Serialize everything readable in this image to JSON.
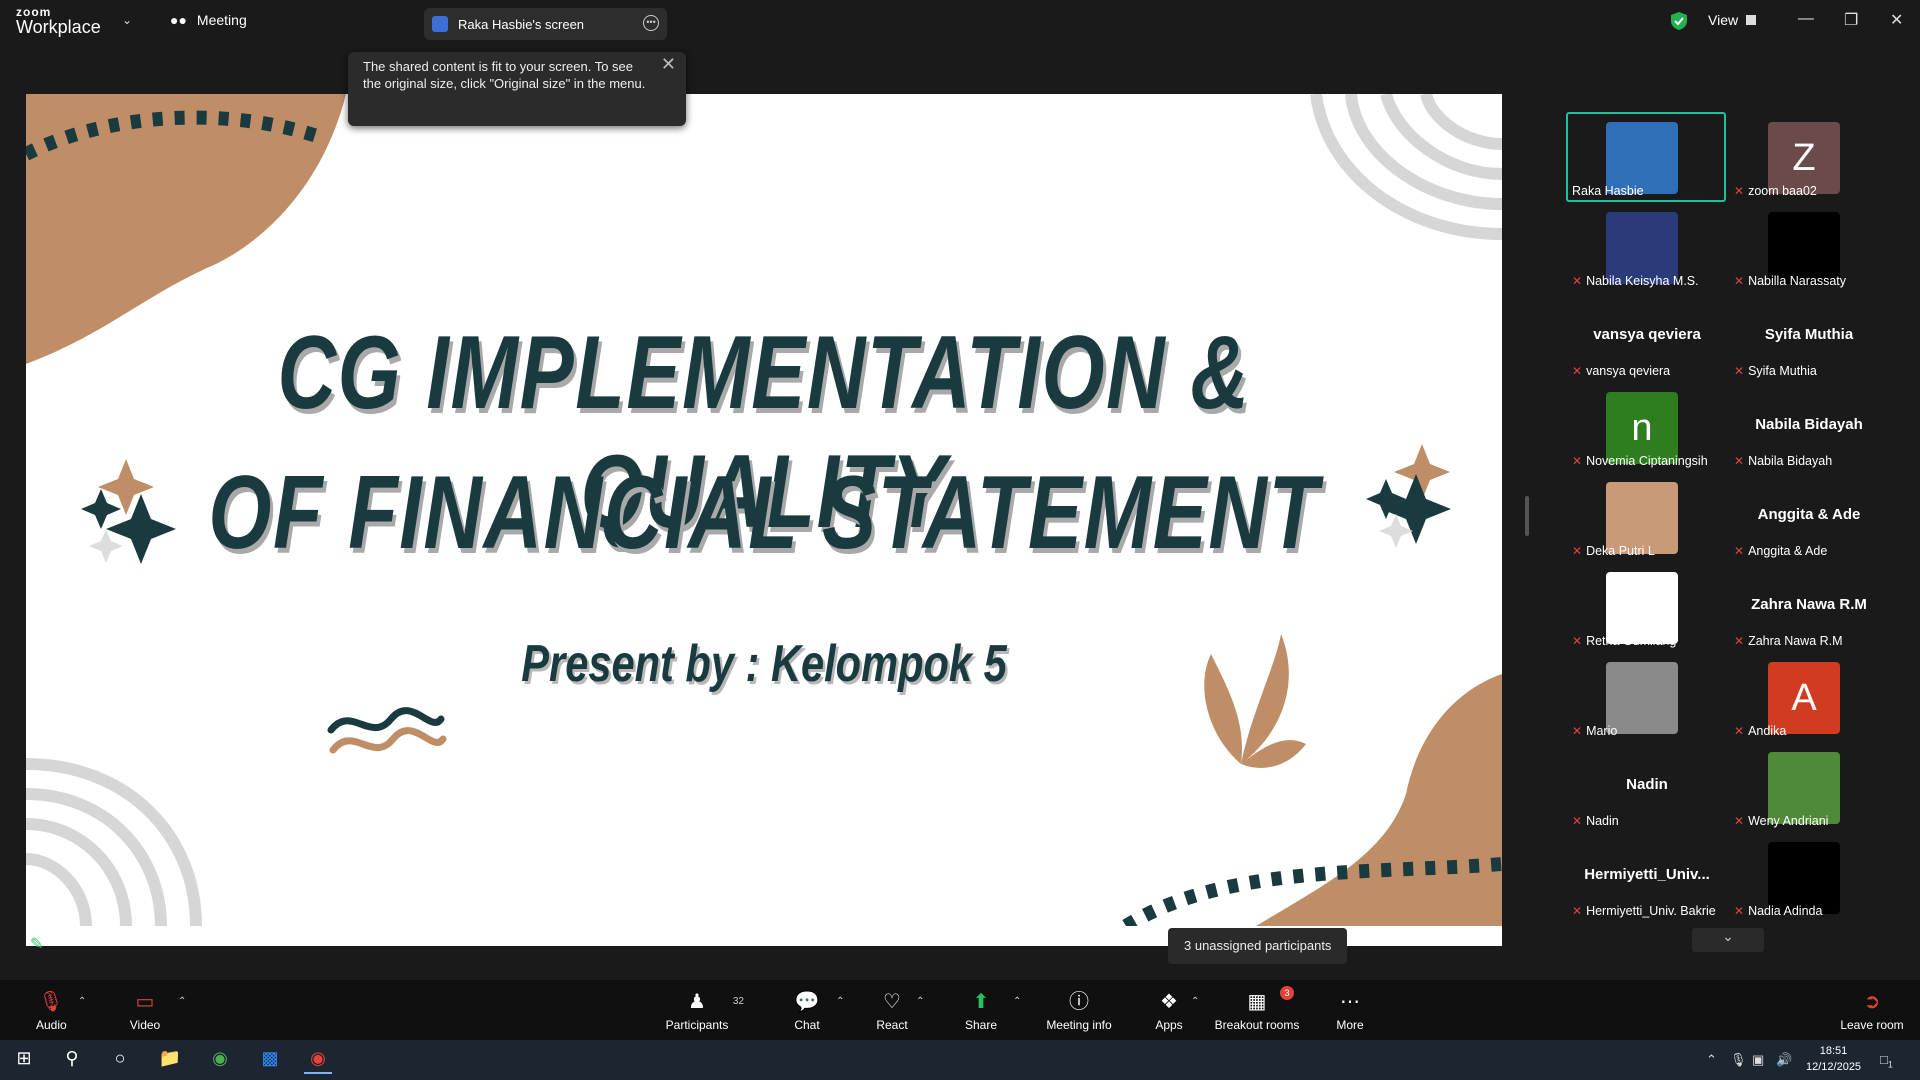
{
  "app": {
    "brand_top": "zoom",
    "brand_bottom": "Workplace"
  },
  "titlebar": {
    "meeting_label": "Meeting",
    "screen_tab": "Raka Hasbie's screen",
    "view_label": "View"
  },
  "tooltip": {
    "text": "The shared content is fit to your screen. To see the original size, click \"Original size\" in the menu."
  },
  "slide": {
    "title_line1": "CG IMPLEMENTATION & QUALITY",
    "title_line2": "OF FINANCIAL STATEMENT",
    "presenter": "Present by : Kelompok 5"
  },
  "unassigned": "3 unassigned participants",
  "participants": [
    {
      "name": "Raka Hasbie",
      "tile": "photo-orca",
      "color": "#2f6fb8",
      "muted": false
    },
    {
      "name": "zoom baa02",
      "tile": "Z",
      "color": "#6b4a4a",
      "muted": true
    },
    {
      "name": "Nabila Keisyha M.S.",
      "tile": "photo",
      "color": "#2a3a7a",
      "muted": true
    },
    {
      "name": "Nabilla Narassaty",
      "tile": "black",
      "color": "#000000",
      "muted": true
    },
    {
      "name": "vansya qeviera",
      "display": "vansya qeviera",
      "muted": true
    },
    {
      "name": "Syifa Muthia",
      "display": "Syifa Muthia",
      "muted": true
    },
    {
      "name": "Novemia Ciptaningsih",
      "tile": "n",
      "color": "#2e7d1f",
      "muted": true
    },
    {
      "name": "Nabila Bidayah",
      "display": "Nabila Bidayah",
      "muted": true
    },
    {
      "name": "Deka Putri L",
      "tile": "photo",
      "color": "#c89a78",
      "muted": true
    },
    {
      "name": "Anggita & Ade",
      "display": "Anggita & Ade",
      "muted": true
    },
    {
      "name": "Retna Gumilang",
      "tile": "white",
      "color": "#ffffff",
      "muted": true
    },
    {
      "name": "Zahra Nawa R.M",
      "display": "Zahra Nawa R.M",
      "muted": true
    },
    {
      "name": "Mario",
      "tile": "photo",
      "color": "#8a8a8a",
      "muted": true
    },
    {
      "name": "Andika",
      "tile": "A",
      "color": "#d13b1f",
      "muted": true
    },
    {
      "name": "Nadin",
      "display": "Nadin",
      "muted": true
    },
    {
      "name": "Weny Andriani",
      "tile": "photo",
      "color": "#4f8a3a",
      "muted": true
    },
    {
      "name": "Hermiyetti_Univ. Bakrie",
      "display": "Hermiyetti_Univ...",
      "muted": true
    },
    {
      "name": "Nadia Adinda",
      "tile": "black",
      "color": "#000000",
      "muted": true
    }
  ],
  "toolbar": {
    "audio": "Audio",
    "video": "Video",
    "participants": "Participants",
    "participants_count": "32",
    "chat": "Chat",
    "react": "React",
    "share": "Share",
    "meeting_info": "Meeting info",
    "apps": "Apps",
    "breakout": "Breakout rooms",
    "breakout_badge": "3",
    "more": "More",
    "leave": "Leave room"
  },
  "taskbar": {
    "time": "18:51",
    "date": "12/12/2025",
    "notif": "1"
  },
  "colors": {
    "slide_text": "#193a3f",
    "accent_tan": "#bf8d66",
    "active_speaker": "#1ec29a",
    "mute_red": "#e0433b"
  }
}
